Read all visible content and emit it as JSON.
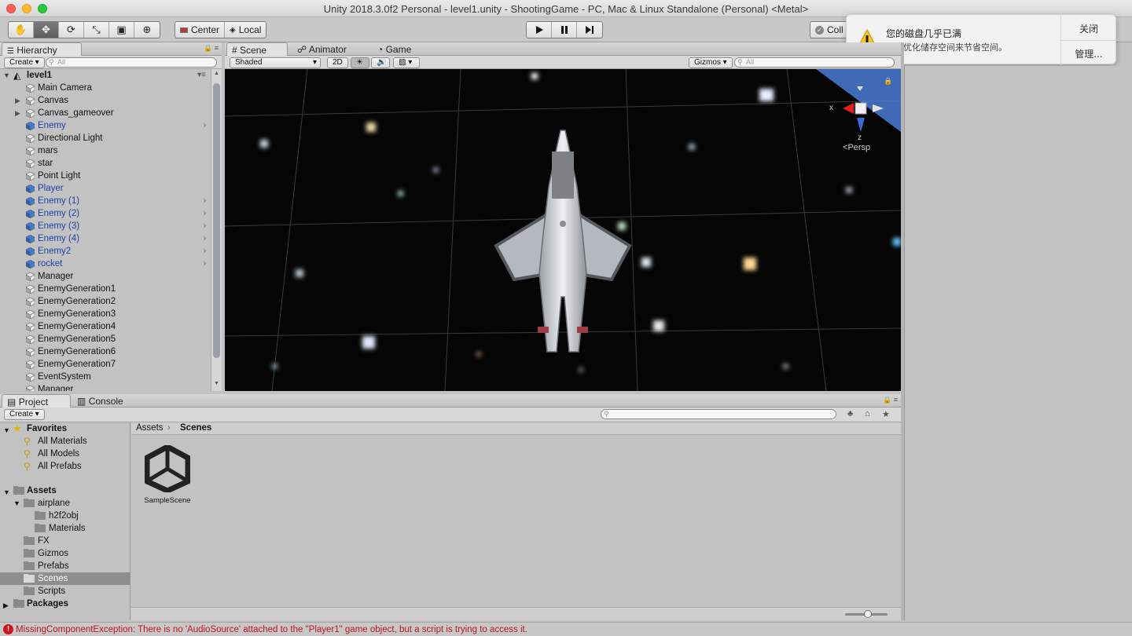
{
  "window": {
    "title": "Unity 2018.3.0f2 Personal - level1.unity - ShootingGame - PC, Mac & Linux Standalone (Personal) <Metal>"
  },
  "toolbar": {
    "tools": [
      "hand-tool",
      "move-tool",
      "rotate-tool",
      "scale-tool",
      "rect-tool",
      "transform-tool"
    ],
    "pivot_label": "Center",
    "space_label": "Local",
    "collab_label": "Coll"
  },
  "notification": {
    "title": "您的磁盘几乎已满",
    "body": "通过优化储存空间来节省空间。",
    "close_label": "关闭",
    "manage_label": "管理..."
  },
  "hierarchy": {
    "tab_label": "Hierarchy",
    "create_label": "Create",
    "search_placeholder": "All",
    "scene_name": "level1",
    "items": [
      {
        "label": "Main Camera",
        "prefab": false,
        "expandable": false,
        "chevron": false
      },
      {
        "label": "Canvas",
        "prefab": false,
        "expandable": true,
        "chevron": false
      },
      {
        "label": "Canvas_gameover",
        "prefab": false,
        "expandable": true,
        "chevron": false
      },
      {
        "label": "Enemy",
        "prefab": true,
        "expandable": false,
        "chevron": true
      },
      {
        "label": "Directional Light",
        "prefab": false,
        "expandable": false,
        "chevron": false
      },
      {
        "label": "mars",
        "prefab": false,
        "expandable": false,
        "chevron": false
      },
      {
        "label": "star",
        "prefab": false,
        "expandable": false,
        "chevron": false
      },
      {
        "label": "Point Light",
        "prefab": false,
        "expandable": false,
        "chevron": false
      },
      {
        "label": "Player",
        "prefab": true,
        "expandable": false,
        "chevron": false
      },
      {
        "label": "Enemy (1)",
        "prefab": true,
        "expandable": false,
        "chevron": true
      },
      {
        "label": "Enemy (2)",
        "prefab": true,
        "expandable": false,
        "chevron": true
      },
      {
        "label": "Enemy (3)",
        "prefab": true,
        "expandable": false,
        "chevron": true
      },
      {
        "label": "Enemy (4)",
        "prefab": true,
        "expandable": false,
        "chevron": true
      },
      {
        "label": "Enemy2",
        "prefab": true,
        "expandable": false,
        "chevron": true
      },
      {
        "label": "rocket",
        "prefab": true,
        "expandable": false,
        "chevron": true
      },
      {
        "label": "Manager",
        "prefab": false,
        "expandable": false,
        "chevron": false
      },
      {
        "label": "EnemyGeneration1",
        "prefab": false,
        "expandable": false,
        "chevron": false
      },
      {
        "label": "EnemyGeneration2",
        "prefab": false,
        "expandable": false,
        "chevron": false
      },
      {
        "label": "EnemyGeneration3",
        "prefab": false,
        "expandable": false,
        "chevron": false
      },
      {
        "label": "EnemyGeneration4",
        "prefab": false,
        "expandable": false,
        "chevron": false
      },
      {
        "label": "EnemyGeneration5",
        "prefab": false,
        "expandable": false,
        "chevron": false
      },
      {
        "label": "EnemyGeneration6",
        "prefab": false,
        "expandable": false,
        "chevron": false
      },
      {
        "label": "EnemyGeneration7",
        "prefab": false,
        "expandable": false,
        "chevron": false
      },
      {
        "label": "EventSystem",
        "prefab": false,
        "expandable": false,
        "chevron": false
      },
      {
        "label": "Manager",
        "prefab": false,
        "expandable": false,
        "chevron": false
      }
    ]
  },
  "scene_tabs": {
    "scene": "Scene",
    "animator": "Animator",
    "game": "Game"
  },
  "scene_toolbar": {
    "shading_mode": "Shaded",
    "mode_2d": "2D",
    "gizmos_label": "Gizmos",
    "search_placeholder": "All"
  },
  "scene_gizmo": {
    "x_label": "x",
    "z_label": "z",
    "projection": "Persp"
  },
  "project": {
    "tab_project": "Project",
    "tab_console": "Console",
    "create_label": "Create",
    "breadcrumb": [
      "Assets",
      "Scenes"
    ],
    "favorites_label": "Favorites",
    "favorites": [
      "All Materials",
      "All Models",
      "All Prefabs"
    ],
    "assets_label": "Assets",
    "folders": [
      {
        "label": "airplane",
        "depth": 1,
        "expandable": true,
        "selected": false
      },
      {
        "label": "h2f2obj",
        "depth": 2,
        "expandable": false,
        "selected": false
      },
      {
        "label": "Materials",
        "depth": 2,
        "expandable": false,
        "selected": false
      },
      {
        "label": "FX",
        "depth": 1,
        "expandable": false,
        "selected": false
      },
      {
        "label": "Gizmos",
        "depth": 1,
        "expandable": false,
        "selected": false
      },
      {
        "label": "Prefabs",
        "depth": 1,
        "expandable": false,
        "selected": false
      },
      {
        "label": "Scenes",
        "depth": 1,
        "expandable": false,
        "selected": true
      },
      {
        "label": "Scripts",
        "depth": 1,
        "expandable": false,
        "selected": false
      }
    ],
    "packages_label": "Packages",
    "assets": [
      {
        "label": "SampleScene"
      }
    ]
  },
  "status": {
    "message": "MissingComponentException: There is no 'AudioSource' attached to the \"Player1\" game object, but a script is trying to access it.",
    "color": "#c0141b"
  },
  "colors": {
    "prefab_text": "#1d3fa8",
    "selected_bg": "#8e8e8e",
    "scene_bg": "#050505"
  }
}
